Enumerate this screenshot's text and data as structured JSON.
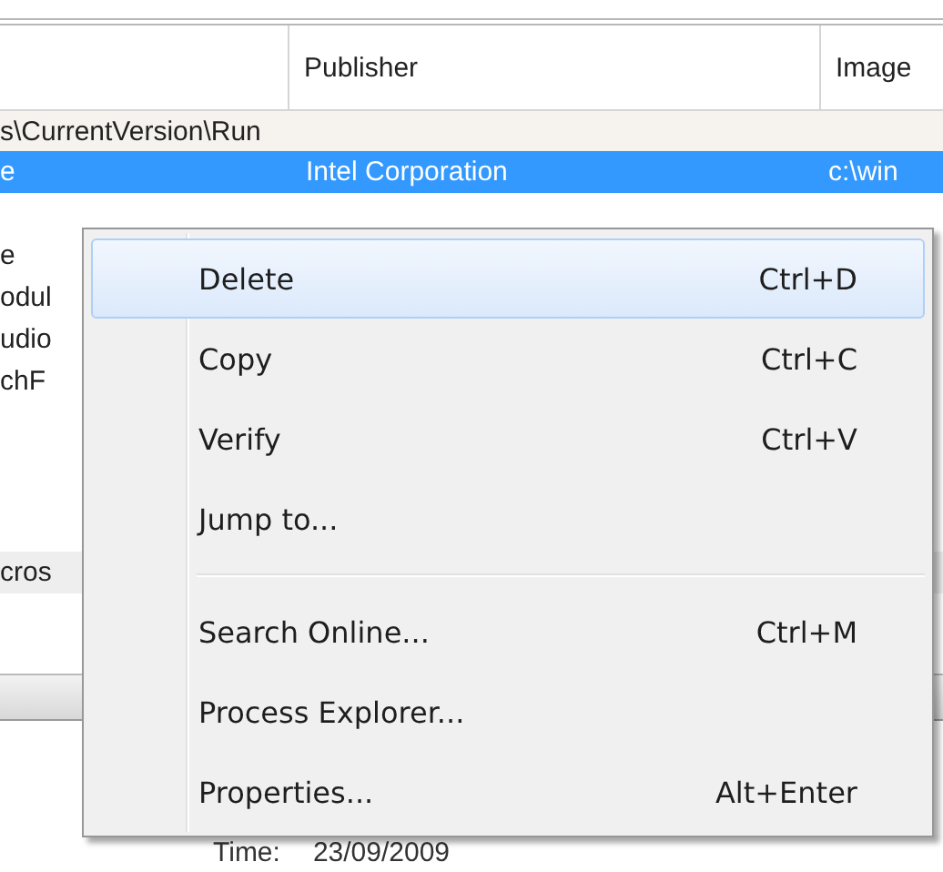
{
  "table": {
    "columns": [
      "Publisher",
      "Image"
    ],
    "group": "s\\CurrentVersion\\Run",
    "rows": [
      {
        "column_1": "e",
        "publisher": "Intel Corporation",
        "image": "c:\\win",
        "selected": true
      },
      {
        "column_1": "e",
        "publisher": "",
        "image": "",
        "selected": false
      },
      {
        "column_1": "odul",
        "publisher": "",
        "image": "",
        "selected": false
      },
      {
        "column_1": "udio",
        "publisher": "",
        "image": "",
        "selected": false
      },
      {
        "column_1": "chF",
        "publisher": "",
        "image": "",
        "selected": false
      }
    ]
  },
  "lower_pane": {
    "text": "cros"
  },
  "details": {
    "label": "Time:",
    "value": "23/09/2009"
  },
  "context_menu": {
    "items": [
      {
        "kind": "item",
        "label": "Delete",
        "shortcut": "Ctrl+D",
        "selected": true
      },
      {
        "kind": "item",
        "label": "Copy",
        "shortcut": "Ctrl+C",
        "selected": false
      },
      {
        "kind": "item",
        "label": "Verify",
        "shortcut": "Ctrl+V",
        "selected": false
      },
      {
        "kind": "item",
        "label": "Jump to...",
        "selected": false
      },
      {
        "kind": "separator"
      },
      {
        "kind": "item",
        "label": "Search Online...",
        "shortcut": "Ctrl+M",
        "selected": false
      },
      {
        "kind": "item",
        "label": "Process Explorer...",
        "selected": false
      },
      {
        "kind": "item",
        "label": "Properties...",
        "shortcut": "Alt+Enter",
        "selected": false
      }
    ]
  }
}
